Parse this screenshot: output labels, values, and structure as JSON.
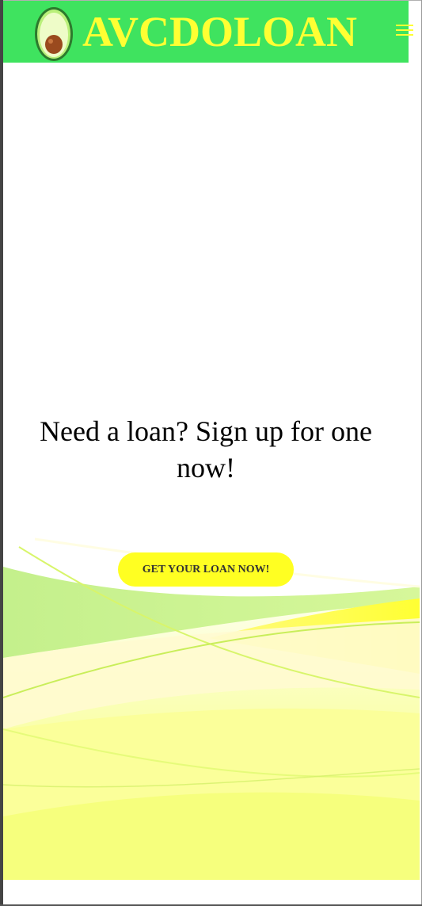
{
  "header": {
    "brand": "AVCDOLOAN",
    "logo_icon": "avocado-icon",
    "menu_icon": "hamburger-menu-icon"
  },
  "hero": {
    "title": "Need a loan? Sign up for one now!",
    "cta_label": "GET YOUR LOAN NOW!"
  },
  "colors": {
    "navbar": "#3fe35f",
    "brand_text": "#ffff33",
    "cta_background": "#ffff22",
    "cta_text": "#333333"
  }
}
